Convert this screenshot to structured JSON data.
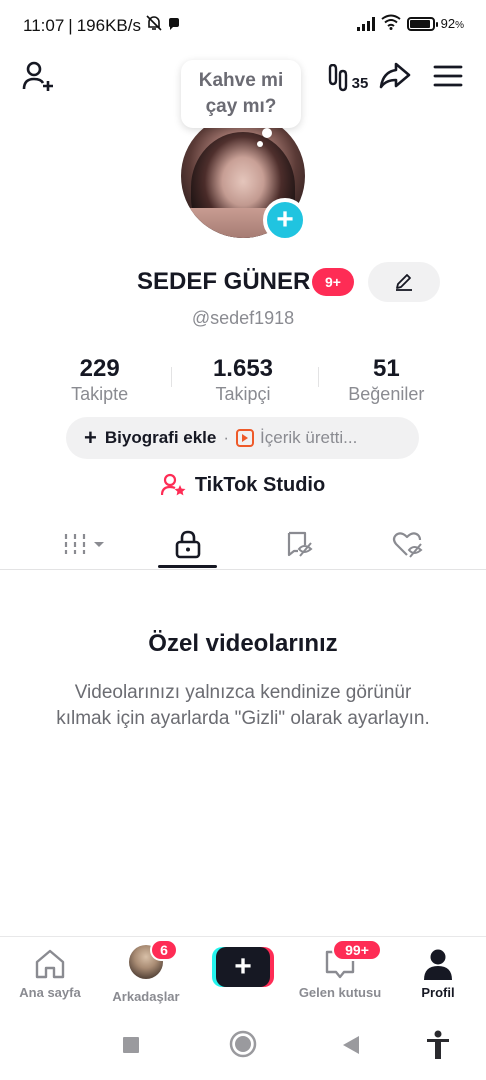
{
  "status_bar": {
    "time": "11:07",
    "separator": "|",
    "speed": "196KB/s",
    "battery": "92",
    "battery_unit": "%",
    "battery_level": 0.92
  },
  "top_bar": {
    "bubble_text_line1": "Kahve mi",
    "bubble_text_line2": "çay mı?",
    "steps_count": "35"
  },
  "profile": {
    "name": "SEDEF GÜNER",
    "name_badge": "9+",
    "username": "@sedef1918"
  },
  "stats": [
    {
      "value": "229",
      "label": "Takipte"
    },
    {
      "value": "1.653",
      "label": "Takipçi"
    },
    {
      "value": "51",
      "label": "Beğeniler"
    }
  ],
  "bio": {
    "plus": "+",
    "add_bio": "Biyografi ekle",
    "dot": "·",
    "content_label": "İçerik üretti..."
  },
  "studio": {
    "label": "TikTok Studio"
  },
  "tabs": [
    {
      "icon": "grid-icon",
      "active": false
    },
    {
      "icon": "lock-icon",
      "active": true
    },
    {
      "icon": "repost-icon",
      "active": false
    },
    {
      "icon": "liked-hidden-icon",
      "active": false
    }
  ],
  "empty_state": {
    "title": "Özel videolarınız",
    "description": "Videolarınızı yalnızca kendinize görünür kılmak için ayarlarda \"Gizli\" olarak ayarlayın."
  },
  "bottom_nav": {
    "home": "Ana sayfa",
    "friends": "Arkadaşlar",
    "friends_badge": "6",
    "create": "+",
    "inbox": "Gelen kutusu",
    "inbox_badge": "99+",
    "profile": "Profil"
  },
  "colors": {
    "accent_red": "#fe2c55",
    "accent_cyan": "#25f4ee",
    "avatar_add": "#20c4e0",
    "text_primary": "#161823",
    "text_secondary": "#8a8b91"
  }
}
